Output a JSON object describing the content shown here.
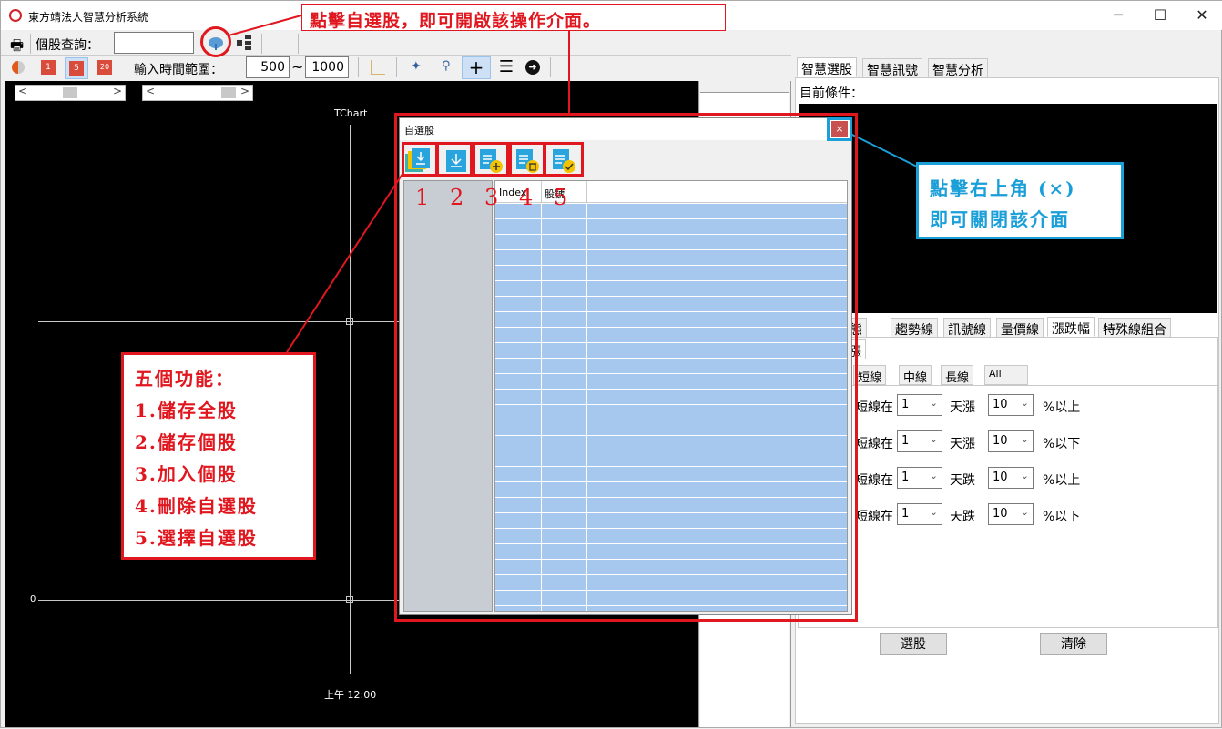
{
  "window": {
    "title": "東方靖法人智慧分析系統"
  },
  "toolbar1": {
    "query_label": "個股查詢：",
    "query_value": ""
  },
  "toolbar2": {
    "range_label": "輸入時間範圍：",
    "range_from": "500",
    "range_sep": "~",
    "range_to": "1000"
  },
  "chart": {
    "title": "TChart",
    "y_label_zero": "0",
    "x_label": "上午 12:00"
  },
  "right_tabs": [
    "智慧選股",
    "智慧訊號",
    "智慧分析"
  ],
  "right_panel": {
    "condition_label": "目前條件：",
    "sub_tabs": [
      "狀態",
      "趨勢線",
      "訊號線",
      "量價線",
      "漲跌幅",
      "特殊線組合"
    ],
    "inner_tab": "漲",
    "line_tabs": [
      "短線",
      "中線",
      "長線",
      "All"
    ],
    "rows": [
      {
        "prefix": "短線在",
        "days": "1",
        "dir": "天漲",
        "pct": "10",
        "suffix": "%以上"
      },
      {
        "prefix": "短線在",
        "days": "1",
        "dir": "天漲",
        "pct": "10",
        "suffix": "%以下"
      },
      {
        "prefix": "短線在",
        "days": "1",
        "dir": "天跌",
        "pct": "10",
        "suffix": "%以上"
      },
      {
        "prefix": "短線在",
        "days": "1",
        "dir": "天跌",
        "pct": "10",
        "suffix": "%以下"
      }
    ],
    "select_button": "選股",
    "clear_button": "清除"
  },
  "dialog": {
    "title": "自選股",
    "close": "×",
    "col_index": "Index",
    "col_code": "股號",
    "tool_icons": [
      "save-all-icon",
      "save-one-icon",
      "add-stock-icon",
      "delete-list-icon",
      "select-list-icon"
    ]
  },
  "annotations": {
    "top_callout": "點擊自選股，即可開啟該操作介面。",
    "numbers": [
      "1",
      "2",
      "3",
      "4",
      "5"
    ],
    "close_hint_line1": "點擊右上角 (×)",
    "close_hint_line2": "即可關閉該介面",
    "functions_title": "五個功能：",
    "functions": [
      "1.儲存全股",
      "2.儲存個股",
      "3.加入個股",
      "4.刪除自選股",
      "5.選擇自選股"
    ]
  },
  "colors": {
    "annotation_red": "#e0171f",
    "annotation_blue": "#1a9fd8",
    "grid_blue": "#a6c8ee"
  }
}
